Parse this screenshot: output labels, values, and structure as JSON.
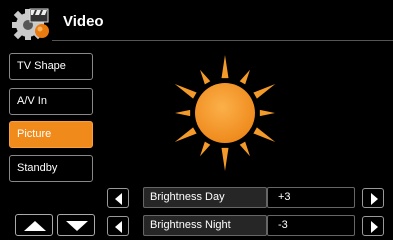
{
  "header": {
    "title": "Video",
    "app_icon": "video-settings-gear-icon"
  },
  "sidebar": {
    "items": [
      {
        "label": "TV Shape",
        "active": false
      },
      {
        "label": "A/V In",
        "active": false
      },
      {
        "label": "Picture",
        "active": true
      },
      {
        "label": "Standby",
        "active": false
      }
    ]
  },
  "preview": {
    "icon": "sun-icon"
  },
  "settings": [
    {
      "label": "Brightness Day",
      "value": "+3"
    },
    {
      "label": "Brightness Night",
      "value": "-3"
    }
  ],
  "colors": {
    "accent": "#f08a1a",
    "background": "#000000",
    "label_bg": "#262626"
  }
}
